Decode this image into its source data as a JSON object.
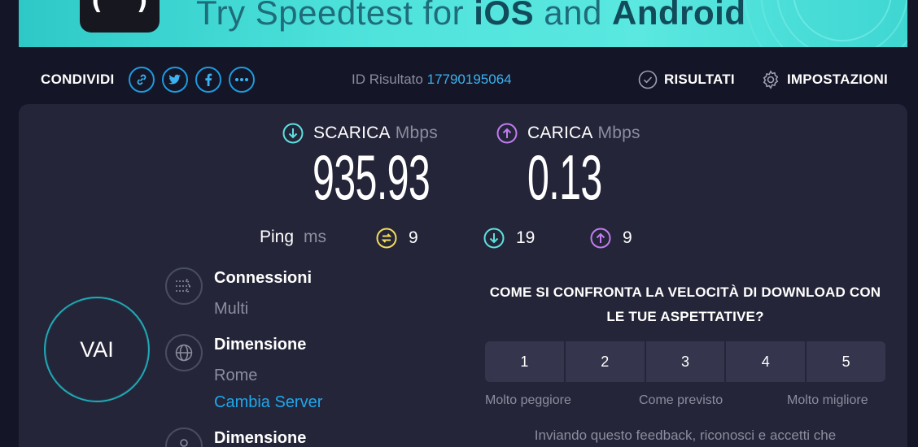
{
  "banner": {
    "text_prefix": "Try Speedtest for ",
    "text_ios": "iOS",
    "text_and": " and ",
    "text_android": "Android"
  },
  "share": {
    "label": "CONDIVIDI",
    "icons": [
      "link-icon",
      "twitter-icon",
      "facebook-icon",
      "more-icon"
    ]
  },
  "result": {
    "label": "ID Risultato",
    "id": "17790195064"
  },
  "nav": {
    "results": "RISULTATI",
    "settings": "IMPOSTAZIONI"
  },
  "download": {
    "label": "SCARICA",
    "unit": "Mbps",
    "value": "935.93"
  },
  "upload": {
    "label": "CARICA",
    "unit": "Mbps",
    "value": "0.13"
  },
  "ping": {
    "label": "Ping",
    "unit": "ms",
    "idle": "9",
    "download": "19",
    "upload": "9"
  },
  "go_button": "VAI",
  "info": {
    "connections_title": "Connessioni",
    "connections_value": "Multi",
    "server_title": "Dimensione",
    "server_value": "Rome",
    "change_server": "Cambia Server",
    "provider_title": "Dimensione"
  },
  "survey": {
    "question": "COME SI CONFRONTA LA VELOCITÀ DI DOWNLOAD CON LE TUE ASPETTATIVE?",
    "options": [
      "1",
      "2",
      "3",
      "4",
      "5"
    ],
    "low": "Molto peggiore",
    "mid": "Come previsto",
    "high": "Molto migliore",
    "note": "Inviando questo feedback, riconosci e accetti che"
  },
  "colors": {
    "accent": "#1c9be0",
    "download": "#5ee0e0",
    "upload": "#c07cf0",
    "ping_idle": "#f2dc5d",
    "background": "#141526",
    "panel": "#242538"
  }
}
